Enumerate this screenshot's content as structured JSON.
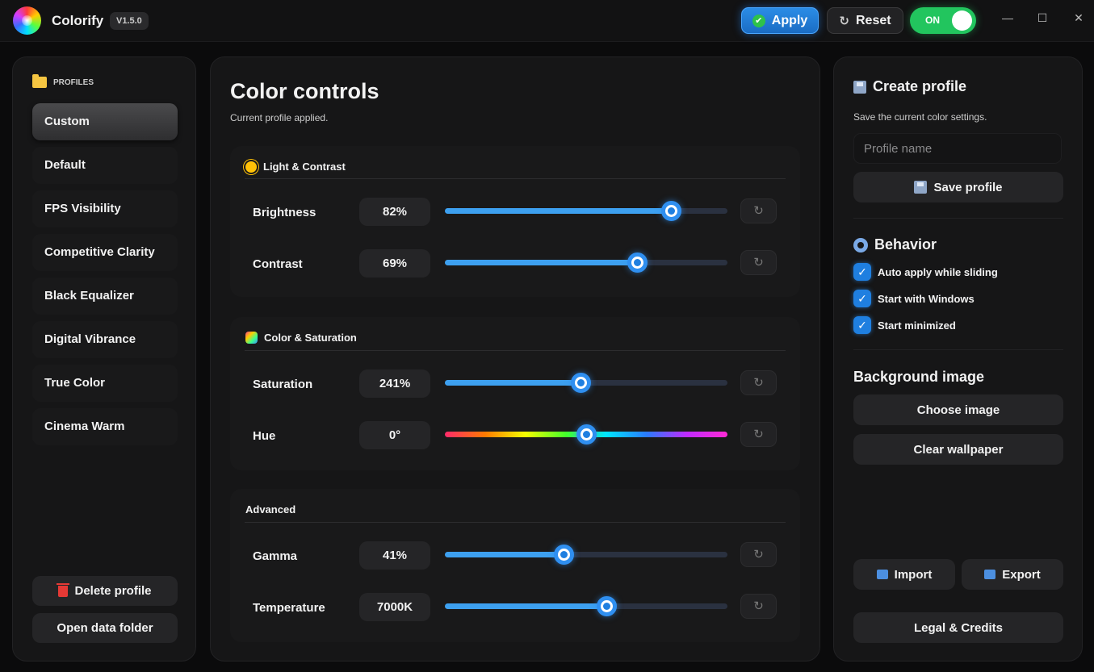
{
  "titlebar": {
    "app_title": "Colorify",
    "version": "V1.5.0",
    "apply_label": "Apply",
    "reset_label": "Reset",
    "power_label": "ON",
    "power_on": true,
    "minimize_glyph": "—",
    "maximize_glyph": "☐",
    "close_glyph": "✕"
  },
  "sidebar": {
    "header": "PROFILES",
    "profiles": [
      {
        "label": "Custom",
        "active": true
      },
      {
        "label": "Default"
      },
      {
        "label": "FPS Visibility"
      },
      {
        "label": "Competitive Clarity"
      },
      {
        "label": "Black Equalizer"
      },
      {
        "label": "Digital Vibrance"
      },
      {
        "label": "True Color"
      },
      {
        "label": "Cinema Warm"
      }
    ],
    "delete_label": "Delete profile",
    "open_folder_label": "Open data folder"
  },
  "main": {
    "title": "Color controls",
    "subtitle": "Current profile applied.",
    "groups": [
      {
        "title": "Light & Contrast",
        "icon": "sun-icon",
        "rows": [
          {
            "label": "Brightness",
            "value": "82%",
            "fraction": 0.8
          },
          {
            "label": "Contrast",
            "value": "69%",
            "fraction": 0.68
          }
        ]
      },
      {
        "title": "Color & Saturation",
        "icon": "color-palette-icon",
        "rows": [
          {
            "label": "Saturation",
            "value": "241%",
            "fraction": 0.48
          },
          {
            "label": "Hue",
            "value": "0°",
            "fraction": 0.5,
            "hue": true
          }
        ]
      },
      {
        "title": "Advanced",
        "icon": "",
        "rows": [
          {
            "label": "Gamma",
            "value": "41%",
            "fraction": 0.42
          },
          {
            "label": "Temperature",
            "value": "7000K",
            "fraction": 0.57
          }
        ]
      }
    ],
    "reset_glyph": "↻"
  },
  "right": {
    "create_title": "Create profile",
    "create_sub": "Save the current color settings.",
    "profile_name_placeholder": "Profile name",
    "profile_name_value": "",
    "save_label": "Save profile",
    "behavior_title": "Behavior",
    "behavior_options": [
      {
        "label": "Auto apply while sliding",
        "checked": true
      },
      {
        "label": "Start with Windows",
        "checked": true
      },
      {
        "label": "Start minimized",
        "checked": true
      }
    ],
    "bg_title": "Background image",
    "choose_image_label": "Choose image",
    "clear_wallpaper_label": "Clear wallpaper",
    "import_label": "Import",
    "export_label": "Export",
    "legal_label": "Legal & Credits"
  },
  "colors": {
    "accent": "#2f8ff0",
    "on_green": "#22c55e",
    "delete_red": "#e53935"
  }
}
